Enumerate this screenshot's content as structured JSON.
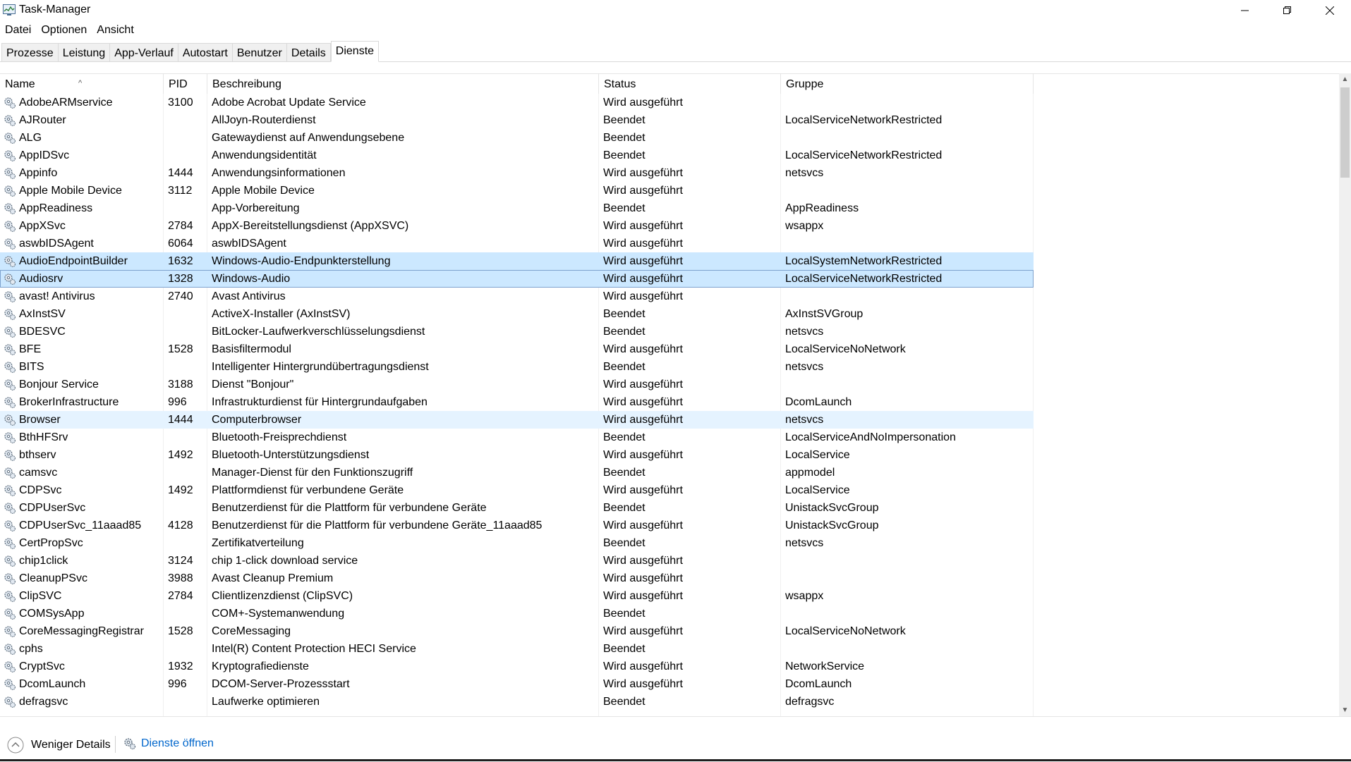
{
  "window": {
    "title": "Task-Manager",
    "controls": {
      "minimize": "—",
      "restore": "❐",
      "close": "✕"
    }
  },
  "menu": [
    "Datei",
    "Optionen",
    "Ansicht"
  ],
  "tabs": [
    {
      "label": "Prozesse",
      "active": false
    },
    {
      "label": "Leistung",
      "active": false
    },
    {
      "label": "App-Verlauf",
      "active": false
    },
    {
      "label": "Autostart",
      "active": false
    },
    {
      "label": "Benutzer",
      "active": false
    },
    {
      "label": "Details",
      "active": false
    },
    {
      "label": "Dienste",
      "active": true
    }
  ],
  "columns": {
    "name": "Name",
    "pid": "PID",
    "description": "Beschreibung",
    "status": "Status",
    "group": "Gruppe",
    "sort_indicator": "^"
  },
  "services": [
    {
      "name": "AdobeARMservice",
      "pid": "3100",
      "description": "Adobe Acrobat Update Service",
      "status": "Wird ausgeführt",
      "group": ""
    },
    {
      "name": "AJRouter",
      "pid": "",
      "description": "AllJoyn-Routerdienst",
      "status": "Beendet",
      "group": "LocalServiceNetworkRestricted"
    },
    {
      "name": "ALG",
      "pid": "",
      "description": "Gatewaydienst auf Anwendungsebene",
      "status": "Beendet",
      "group": ""
    },
    {
      "name": "AppIDSvc",
      "pid": "",
      "description": "Anwendungsidentität",
      "status": "Beendet",
      "group": "LocalServiceNetworkRestricted"
    },
    {
      "name": "Appinfo",
      "pid": "1444",
      "description": "Anwendungsinformationen",
      "status": "Wird ausgeführt",
      "group": "netsvcs"
    },
    {
      "name": "Apple Mobile Device",
      "pid": "3112",
      "description": "Apple Mobile Device",
      "status": "Wird ausgeführt",
      "group": ""
    },
    {
      "name": "AppReadiness",
      "pid": "",
      "description": "App-Vorbereitung",
      "status": "Beendet",
      "group": "AppReadiness"
    },
    {
      "name": "AppXSvc",
      "pid": "2784",
      "description": "AppX-Bereitstellungsdienst (AppXSVC)",
      "status": "Wird ausgeführt",
      "group": "wsappx"
    },
    {
      "name": "aswbIDSAgent",
      "pid": "6064",
      "description": "aswbIDSAgent",
      "status": "Wird ausgeführt",
      "group": ""
    },
    {
      "name": "AudioEndpointBuilder",
      "pid": "1632",
      "description": "Windows-Audio-Endpunkterstellung",
      "status": "Wird ausgeführt",
      "group": "LocalSystemNetworkRestricted",
      "highlight": "selected"
    },
    {
      "name": "Audiosrv",
      "pid": "1328",
      "description": "Windows-Audio",
      "status": "Wird ausgeführt",
      "group": "LocalServiceNetworkRestricted",
      "highlight": "focused"
    },
    {
      "name": "avast! Antivirus",
      "pid": "2740",
      "description": "Avast Antivirus",
      "status": "Wird ausgeführt",
      "group": ""
    },
    {
      "name": "AxInstSV",
      "pid": "",
      "description": "ActiveX-Installer (AxInstSV)",
      "status": "Beendet",
      "group": "AxInstSVGroup"
    },
    {
      "name": "BDESVC",
      "pid": "",
      "description": "BitLocker-Laufwerkverschlüsselungsdienst",
      "status": "Beendet",
      "group": "netsvcs"
    },
    {
      "name": "BFE",
      "pid": "1528",
      "description": "Basisfiltermodul",
      "status": "Wird ausgeführt",
      "group": "LocalServiceNoNetwork"
    },
    {
      "name": "BITS",
      "pid": "",
      "description": "Intelligenter Hintergrundübertragungsdienst",
      "status": "Beendet",
      "group": "netsvcs"
    },
    {
      "name": "Bonjour Service",
      "pid": "3188",
      "description": "Dienst \"Bonjour\"",
      "status": "Wird ausgeführt",
      "group": ""
    },
    {
      "name": "BrokerInfrastructure",
      "pid": "996",
      "description": "Infrastrukturdienst für Hintergrundaufgaben",
      "status": "Wird ausgeführt",
      "group": "DcomLaunch"
    },
    {
      "name": "Browser",
      "pid": "1444",
      "description": "Computerbrowser",
      "status": "Wird ausgeführt",
      "group": "netsvcs",
      "highlight": "hover"
    },
    {
      "name": "BthHFSrv",
      "pid": "",
      "description": "Bluetooth-Freisprechdienst",
      "status": "Beendet",
      "group": "LocalServiceAndNoImpersonation"
    },
    {
      "name": "bthserv",
      "pid": "1492",
      "description": "Bluetooth-Unterstützungsdienst",
      "status": "Wird ausgeführt",
      "group": "LocalService"
    },
    {
      "name": "camsvc",
      "pid": "",
      "description": "Manager-Dienst für den Funktionszugriff",
      "status": "Beendet",
      "group": "appmodel"
    },
    {
      "name": "CDPSvc",
      "pid": "1492",
      "description": "Plattformdienst für verbundene Geräte",
      "status": "Wird ausgeführt",
      "group": "LocalService"
    },
    {
      "name": "CDPUserSvc",
      "pid": "",
      "description": "Benutzerdienst für die Plattform für verbundene Geräte",
      "status": "Beendet",
      "group": "UnistackSvcGroup"
    },
    {
      "name": "CDPUserSvc_11aaad85",
      "pid": "4128",
      "description": "Benutzerdienst für die Plattform für verbundene Geräte_11aaad85",
      "status": "Wird ausgeführt",
      "group": "UnistackSvcGroup"
    },
    {
      "name": "CertPropSvc",
      "pid": "",
      "description": "Zertifikatverteilung",
      "status": "Beendet",
      "group": "netsvcs"
    },
    {
      "name": "chip1click",
      "pid": "3124",
      "description": "chip 1-click download service",
      "status": "Wird ausgeführt",
      "group": ""
    },
    {
      "name": "CleanupPSvc",
      "pid": "3988",
      "description": "Avast Cleanup Premium",
      "status": "Wird ausgeführt",
      "group": ""
    },
    {
      "name": "ClipSVC",
      "pid": "2784",
      "description": "Clientlizenzdienst (ClipSVC)",
      "status": "Wird ausgeführt",
      "group": "wsappx"
    },
    {
      "name": "COMSysApp",
      "pid": "",
      "description": "COM+-Systemanwendung",
      "status": "Beendet",
      "group": ""
    },
    {
      "name": "CoreMessagingRegistrar",
      "pid": "1528",
      "description": "CoreMessaging",
      "status": "Wird ausgeführt",
      "group": "LocalServiceNoNetwork"
    },
    {
      "name": "cphs",
      "pid": "",
      "description": "Intel(R) Content Protection HECI Service",
      "status": "Beendet",
      "group": ""
    },
    {
      "name": "CryptSvc",
      "pid": "1932",
      "description": "Kryptografiedienste",
      "status": "Wird ausgeführt",
      "group": "NetworkService"
    },
    {
      "name": "DcomLaunch",
      "pid": "996",
      "description": "DCOM-Server-Prozessstart",
      "status": "Wird ausgeführt",
      "group": "DcomLaunch"
    },
    {
      "name": "defragsvc",
      "pid": "",
      "description": "Laufwerke optimieren",
      "status": "Beendet",
      "group": "defragsvc"
    }
  ],
  "footer": {
    "fewer_details": "Weniger Details",
    "open_services": "Dienste öffnen"
  },
  "colors": {
    "selected_row": "#cce8ff",
    "hover_row": "#e5f3ff",
    "link": "#0066cc"
  }
}
